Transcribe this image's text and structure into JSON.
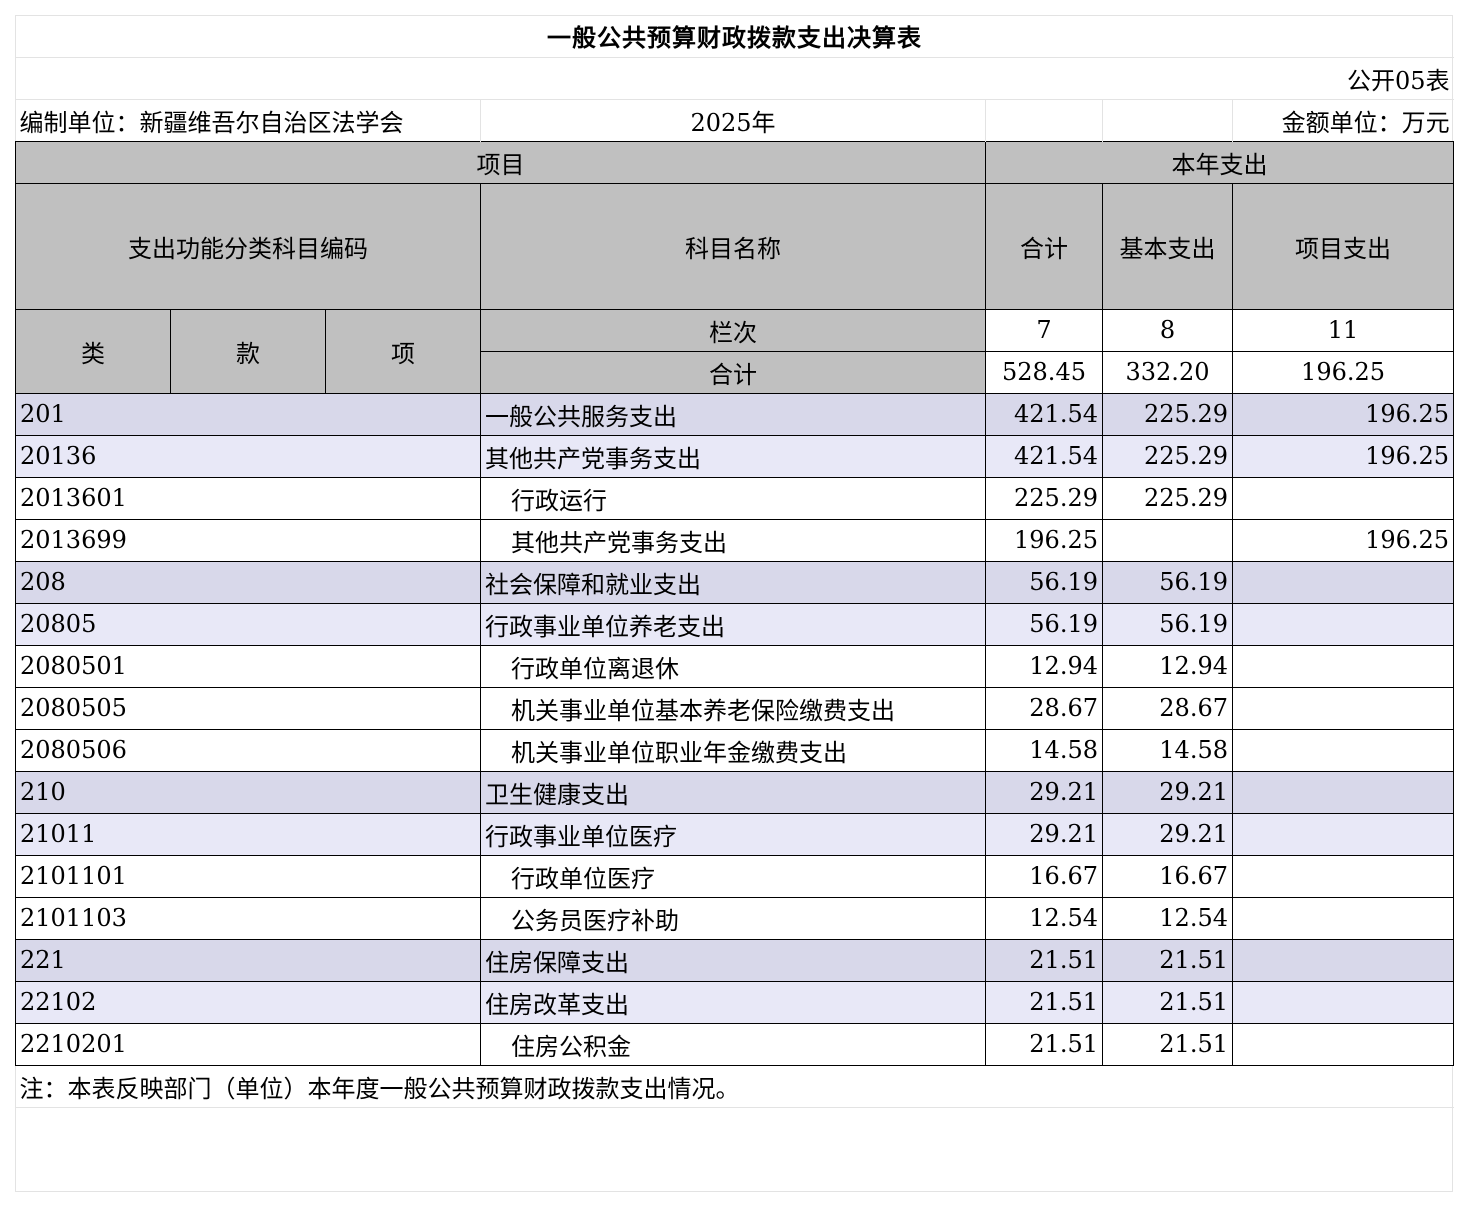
{
  "title": "一般公共预算财政拨款支出决算表",
  "form_no": "公开05表",
  "unit_label": "编制单位：新疆维吾尔自治区法学会",
  "year": "2025年",
  "amount_unit": "金额单位：万元",
  "header": {
    "item": "项目",
    "current_year_spending": "本年支出",
    "func_code": "支出功能分类科目编码",
    "subject_name": "科目名称",
    "total": "合计",
    "basic": "基本支出",
    "project": "项目支出",
    "cat": "类",
    "section": "款",
    "sub": "项",
    "column_no": "栏次",
    "col_total_no": "7",
    "col_basic_no": "8",
    "col_project_no": "11",
    "grand_total_label": "合计",
    "grand_total": "528.45",
    "grand_basic": "332.20",
    "grand_project": "196.25"
  },
  "rows": [
    {
      "code": "201",
      "name": "一般公共服务支出",
      "total": "421.54",
      "basic": "225.29",
      "project": "196.25",
      "level": 1
    },
    {
      "code": "20136",
      "name": "其他共产党事务支出",
      "total": "421.54",
      "basic": "225.29",
      "project": "196.25",
      "level": 2
    },
    {
      "code": "2013601",
      "name": "行政运行",
      "total": "225.29",
      "basic": "225.29",
      "project": "",
      "level": 3
    },
    {
      "code": "2013699",
      "name": "其他共产党事务支出",
      "total": "196.25",
      "basic": "",
      "project": "196.25",
      "level": 3
    },
    {
      "code": "208",
      "name": "社会保障和就业支出",
      "total": "56.19",
      "basic": "56.19",
      "project": "",
      "level": 1
    },
    {
      "code": "20805",
      "name": "行政事业单位养老支出",
      "total": "56.19",
      "basic": "56.19",
      "project": "",
      "level": 2
    },
    {
      "code": "2080501",
      "name": "行政单位离退休",
      "total": "12.94",
      "basic": "12.94",
      "project": "",
      "level": 3
    },
    {
      "code": "2080505",
      "name": "机关事业单位基本养老保险缴费支出",
      "total": "28.67",
      "basic": "28.67",
      "project": "",
      "level": 3
    },
    {
      "code": "2080506",
      "name": "机关事业单位职业年金缴费支出",
      "total": "14.58",
      "basic": "14.58",
      "project": "",
      "level": 3
    },
    {
      "code": "210",
      "name": "卫生健康支出",
      "total": "29.21",
      "basic": "29.21",
      "project": "",
      "level": 1
    },
    {
      "code": "21011",
      "name": "行政事业单位医疗",
      "total": "29.21",
      "basic": "29.21",
      "project": "",
      "level": 2
    },
    {
      "code": "2101101",
      "name": "行政单位医疗",
      "total": "16.67",
      "basic": "16.67",
      "project": "",
      "level": 3
    },
    {
      "code": "2101103",
      "name": "公务员医疗补助",
      "total": "12.54",
      "basic": "12.54",
      "project": "",
      "level": 3
    },
    {
      "code": "221",
      "name": "住房保障支出",
      "total": "21.51",
      "basic": "21.51",
      "project": "",
      "level": 1
    },
    {
      "code": "22102",
      "name": "住房改革支出",
      "total": "21.51",
      "basic": "21.51",
      "project": "",
      "level": 2
    },
    {
      "code": "2210201",
      "name": "住房公积金",
      "total": "21.51",
      "basic": "21.51",
      "project": "",
      "level": 3
    }
  ],
  "note": "注：本表反映部门（单位）本年度一般公共预算财政拨款支出情况。"
}
